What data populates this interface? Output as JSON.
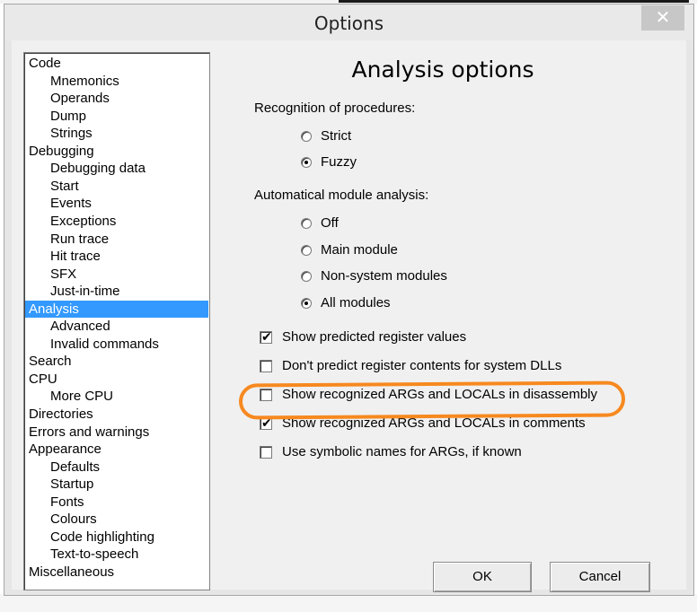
{
  "window": {
    "title": "Options",
    "close_glyph": "✕"
  },
  "tree": {
    "items": [
      {
        "label": "Code",
        "level": 0
      },
      {
        "label": "Mnemonics",
        "level": 1
      },
      {
        "label": "Operands",
        "level": 1
      },
      {
        "label": "Dump",
        "level": 1
      },
      {
        "label": "Strings",
        "level": 1
      },
      {
        "label": "Debugging",
        "level": 0
      },
      {
        "label": "Debugging data",
        "level": 1
      },
      {
        "label": "Start",
        "level": 1
      },
      {
        "label": "Events",
        "level": 1
      },
      {
        "label": "Exceptions",
        "level": 1
      },
      {
        "label": "Run trace",
        "level": 1
      },
      {
        "label": "Hit trace",
        "level": 1
      },
      {
        "label": "SFX",
        "level": 1
      },
      {
        "label": "Just-in-time",
        "level": 1
      },
      {
        "label": "Analysis",
        "level": 0,
        "selected": true
      },
      {
        "label": "Advanced",
        "level": 1
      },
      {
        "label": "Invalid commands",
        "level": 1
      },
      {
        "label": "Search",
        "level": 0
      },
      {
        "label": "CPU",
        "level": 0
      },
      {
        "label": "More CPU",
        "level": 1
      },
      {
        "label": "Directories",
        "level": 0
      },
      {
        "label": "Errors and warnings",
        "level": 0
      },
      {
        "label": "Appearance",
        "level": 0
      },
      {
        "label": "Defaults",
        "level": 1
      },
      {
        "label": "Startup",
        "level": 1
      },
      {
        "label": "Fonts",
        "level": 1
      },
      {
        "label": "Colours",
        "level": 1
      },
      {
        "label": "Code highlighting",
        "level": 1
      },
      {
        "label": "Text-to-speech",
        "level": 1
      },
      {
        "label": "Miscellaneous",
        "level": 0
      }
    ]
  },
  "panel": {
    "title": "Analysis options",
    "procedures": {
      "label": "Recognition of procedures:",
      "options": [
        {
          "label": "Strict",
          "selected": false
        },
        {
          "label": "Fuzzy",
          "selected": true
        }
      ]
    },
    "modules": {
      "label": "Automatical module analysis:",
      "options": [
        {
          "label": "Off",
          "selected": false
        },
        {
          "label": "Main module",
          "selected": false
        },
        {
          "label": "Non-system modules",
          "selected": false
        },
        {
          "label": "All modules",
          "selected": true
        }
      ]
    },
    "checks": [
      {
        "label": "Show predicted register values",
        "checked": true
      },
      {
        "label": "Don't predict register contents for system DLLs",
        "checked": false
      },
      {
        "label": "Show recognized ARGs and LOCALs in disassembly",
        "checked": false,
        "highlighted": true
      },
      {
        "label": "Show recognized ARGs and LOCALs in comments",
        "checked": true
      },
      {
        "label": "Use symbolic names for ARGs, if known",
        "checked": false
      }
    ]
  },
  "buttons": {
    "ok": "OK",
    "cancel": "Cancel"
  },
  "colors": {
    "selection": "#3399ff",
    "highlight_ring": "#f7891f"
  }
}
